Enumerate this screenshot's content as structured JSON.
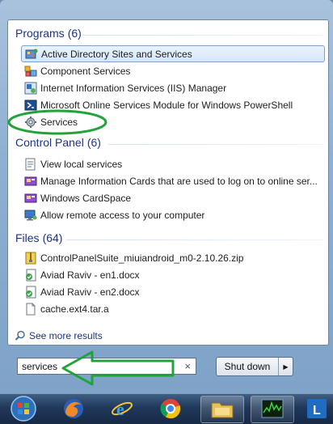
{
  "programs": {
    "header": "Programs",
    "count": "(6)",
    "items": [
      {
        "label": "Active Directory Sites and Services",
        "icon": "ad-sites-icon"
      },
      {
        "label": "Component Services",
        "icon": "component-services-icon"
      },
      {
        "label": "Internet Information Services (IIS) Manager",
        "icon": "iis-manager-icon"
      },
      {
        "label": "Microsoft Online Services Module for Windows PowerShell",
        "icon": "powershell-icon"
      },
      {
        "label": "Services",
        "icon": "services-gear-icon"
      }
    ]
  },
  "control_panel": {
    "header": "Control Panel",
    "count": "(6)",
    "items": [
      {
        "label": "View local services",
        "icon": "view-services-icon"
      },
      {
        "label": "Manage Information Cards that are used to log on to online ser...",
        "icon": "info-cards-icon"
      },
      {
        "label": "Windows CardSpace",
        "icon": "cardspace-icon"
      },
      {
        "label": "Allow remote access to your computer",
        "icon": "remote-access-icon"
      }
    ]
  },
  "files": {
    "header": "Files",
    "count": "(64)",
    "items": [
      {
        "label": "ControlPanelSuite_miuiandroid_m0-2.10.26.zip",
        "icon": "zip-file-icon"
      },
      {
        "label": "Aviad Raviv - en1.docx",
        "icon": "docx-file-icon"
      },
      {
        "label": "Aviad Raviv - en2.docx",
        "icon": "docx-file-icon"
      },
      {
        "label": "cache.ext4.tar.a",
        "icon": "generic-file-icon"
      }
    ]
  },
  "see_more": "See more results",
  "search": {
    "value": "services",
    "clear": "×"
  },
  "shutdown": {
    "label": "Shut down",
    "arrow": "▶"
  },
  "colors": {
    "header_blue": "#1e3287",
    "annotation_green": "#21a33a",
    "selection_border": "#7da2ce"
  },
  "taskbar": {
    "icons": [
      "windows-orb-icon",
      "firefox-icon",
      "internet-explorer-icon",
      "chrome-icon",
      "windows-explorer-icon",
      "resource-monitor-icon",
      "outlook-lync-icon"
    ]
  }
}
